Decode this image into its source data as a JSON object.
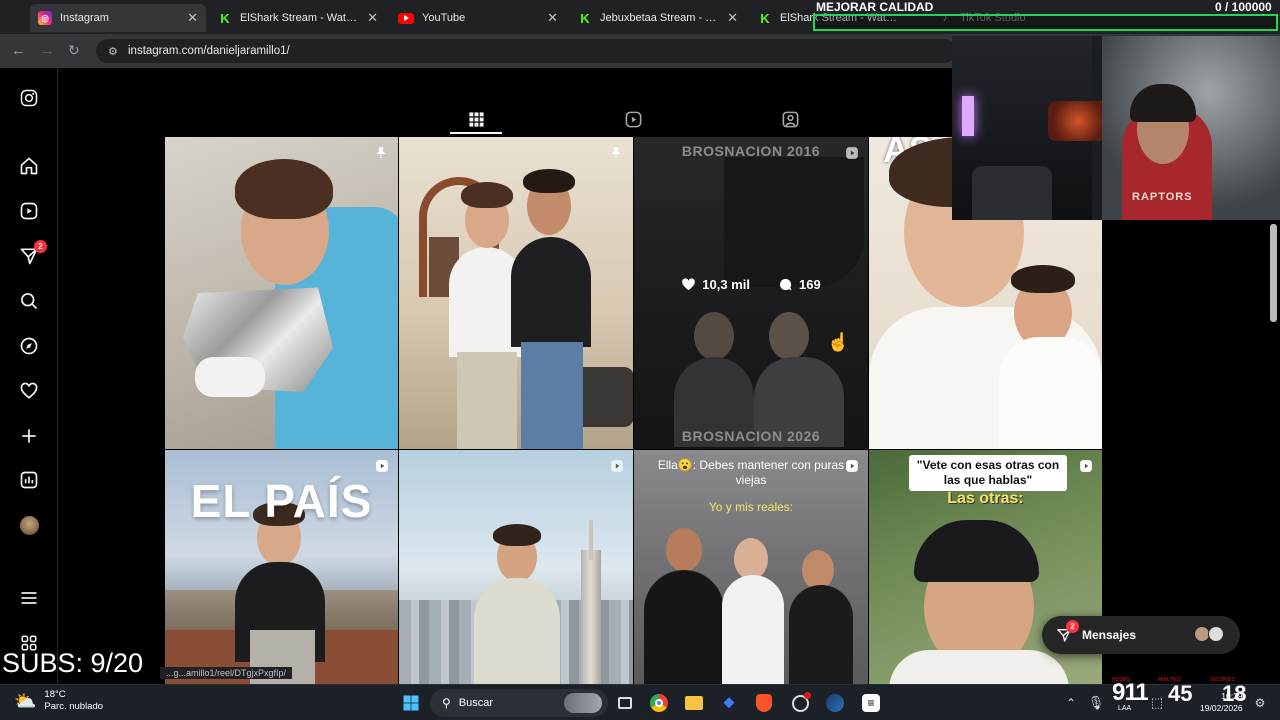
{
  "browser": {
    "tabs": [
      {
        "label": "Instagram",
        "icon": "instagram-icon",
        "active": true
      },
      {
        "label": "ElShark Stream - Watch Live",
        "icon": "kick-icon"
      },
      {
        "label": "YouTube",
        "icon": "youtube-icon"
      },
      {
        "label": "Jebuxbetaa Stream - Watch",
        "icon": "kick-icon"
      },
      {
        "label": "ElShark Stream - Watch Live",
        "icon": "kick-icon"
      },
      {
        "label": "TikTok Studio",
        "icon": "tiktok-icon"
      }
    ],
    "url": "instagram.com/danieljaramillo1/"
  },
  "instagram": {
    "rail_badge": "2",
    "active_tab": "posts-grid",
    "posts": [
      {
        "pinned": true
      },
      {
        "pinned": true
      },
      {
        "top_text": "BROSNACION 2016",
        "bottom_text": "BROSNACION 2026",
        "likes": "10,3 mil",
        "comments": "169",
        "hovered": true
      },
      {
        "top_text": "AS"
      },
      {
        "top_text": "EL PAÍS",
        "reel": true
      },
      {
        "reel": true
      },
      {
        "caption": "Ella😮: Debes mantener con puras viejas",
        "caption2": "Yo y mis reales:",
        "reel": true
      },
      {
        "caption": "\"Vete con esas otras con las que hablas\"",
        "caption2": "Las otras:",
        "reel": true
      }
    ],
    "messages_label": "Mensajes",
    "messages_badge": "2",
    "status_url": "...g...amillo1/reel/DTgjxPxgfIp/"
  },
  "stream_overlay": {
    "quality_label": "MEJORAR CALIDAD",
    "goal_text": "0 / 100000",
    "subs_text": "SUBS: 9/20",
    "webcam_shirt_text": "RAPTORS"
  },
  "taskbar": {
    "weather_temp": "18°C",
    "weather_desc": "Parc. nublado",
    "search_placeholder": "Buscar",
    "stream_timer": {
      "hours": "9",
      "minutes": "11",
      "seconds": "45",
      "big": "18"
    },
    "timer_labels": {
      "hours": "HOURS",
      "minutes": "MINUTES",
      "seconds": "SECONDS"
    },
    "lang": "LAA",
    "time": "10:29",
    "date": "19/02/2026"
  },
  "colors": {
    "accent_green": "#1fd655",
    "instagram_bg": "#000000",
    "badge_red": "#ff3040"
  }
}
